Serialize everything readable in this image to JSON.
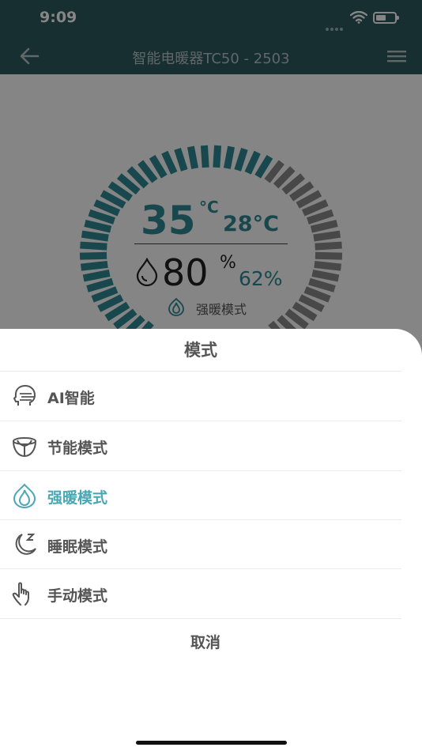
{
  "status": {
    "time": "9:09"
  },
  "nav": {
    "title": "智能电暖器TC50 - 2503"
  },
  "gauge": {
    "temperature": "35",
    "temp_unit": "°C",
    "set_temperature": "28°C",
    "humidity": "80",
    "humidity_unit": "%",
    "set_humidity": "62%",
    "mode": "强暖模式",
    "fill_fraction": 0.6
  },
  "sheet": {
    "title": "模式",
    "options": [
      {
        "label": "AI智能",
        "icon": "ai-head-icon",
        "active": false
      },
      {
        "label": "节能模式",
        "icon": "leaf-bowl-icon",
        "active": false
      },
      {
        "label": "强暖模式",
        "icon": "flame-icon",
        "active": true
      },
      {
        "label": "睡眠模式",
        "icon": "moon-sleep-icon",
        "active": false
      },
      {
        "label": "手动模式",
        "icon": "hand-pointer-icon",
        "active": false
      }
    ],
    "cancel": "取消"
  },
  "colors": {
    "accent": "#4ba7b3",
    "header": "#2d5a5e",
    "text": "#555555"
  }
}
